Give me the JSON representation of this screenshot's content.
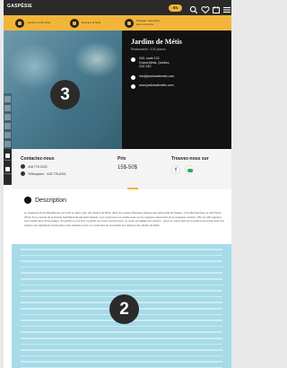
{
  "header": {
    "logo": "GASPÉSIE",
    "logo_tag": "",
    "language": "EN",
    "icons": [
      "search-icon",
      "heart-icon",
      "calendar-icon",
      "menu-icon"
    ]
  },
  "actions": [
    {
      "icon": "save-icon",
      "label": "Imprimer cette fiche"
    },
    {
      "icon": "send-icon",
      "label": "Envoyer la fiche"
    },
    {
      "icon": "share-icon",
      "label": "Partager cette fiche avec vos amis"
    }
  ],
  "listing": {
    "title": "Jardins de Métis",
    "subtitle": "Restaurants / 130 places",
    "address_lines": [
      "200, route 132",
      "Grand-Métis, Québec",
      "G0J 1Z0"
    ],
    "email": "info@jardinsdemetis.com",
    "website": "www.jardinsdemetis.com"
  },
  "rail": {
    "items": [
      "Contact",
      "Partager"
    ]
  },
  "contact": {
    "heading": "Contactez-nous",
    "phone": "418 775-2222",
    "fax": "Télécopieur : 418 775-6201"
  },
  "price": {
    "heading": "Prix",
    "value": "15$-50$"
  },
  "social": {
    "heading": "Trouvez-nous sur"
  },
  "description": {
    "heading": "Description",
    "body": "Le restaurant de la Villa Estevan est niché en plein cœur des Jardins de Métis, dans une maison historique classée site patrimonial du Québec. À la villa historique, le chef Pierre-Olivier Ferry, lauréat de la Société Gastrilland Restaurants Awards, vous proposera une cuisine axée sur les végétaux saisonniers de la Gaspésie maritime. Plus de 100 végétaux sont cueillis dans notre potager, nos jardins et nos bois. Le jardin est ouvert tous les jours. Le menu est adapté aux saisons : venez en savoir plus sur le jardin et la cuisine selon les saisons, les ingrédients choisis dans votre assiette et plus. Le restaurant est accessible aux visiteurs des Jardins de Métis."
  },
  "annotations": {
    "hero_marker": "3",
    "region_marker": "2"
  },
  "colors": {
    "accent": "#f2b53a",
    "dark": "#121212",
    "region": "#a7dbe8"
  }
}
